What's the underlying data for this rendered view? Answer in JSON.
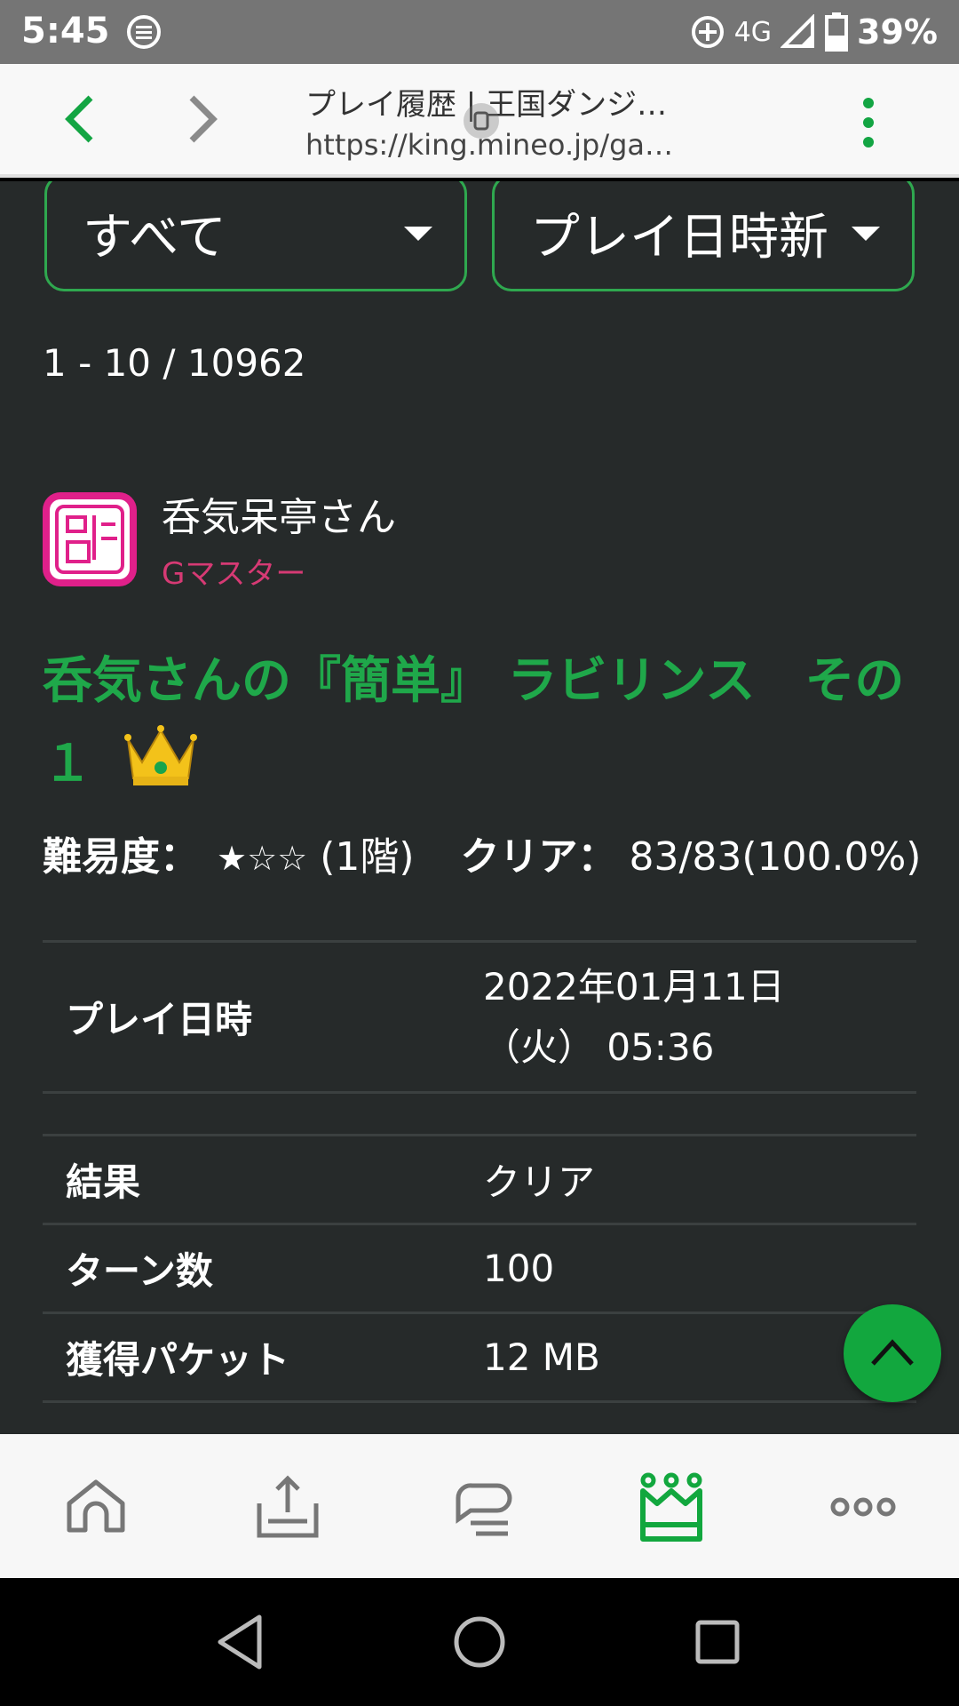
{
  "status": {
    "time": "5:45",
    "network": "4G",
    "battery": "39%"
  },
  "browser": {
    "page_title": "プレイ履歴 | 王国ダンジ…",
    "url": "https://king.mineo.jp/ga…"
  },
  "filters": {
    "category": "すべて",
    "sort": "プレイ日時新"
  },
  "results": {
    "count": "1 - 10 / 10962"
  },
  "entry": {
    "user_name": "呑気呆亭さん",
    "user_rank": "Gマスター",
    "title": "呑気さんの『簡単』 ラビリンス　その１",
    "difficulty_label": "難易度：",
    "difficulty_stars": "★☆☆",
    "difficulty_floors": "(1階)",
    "clear_label": "クリア：",
    "clear_value": "83/83(100.0%)",
    "details": {
      "played_at_label": "プレイ日時",
      "played_at_date": "2022年01月11日",
      "played_at_time": "（火）  05:36",
      "result_label": "結果",
      "result_value": "クリア",
      "turns_label": "ターン数",
      "turns_value": "100",
      "packet_label": "獲得パケット",
      "packet_value": "12 MB"
    }
  },
  "icons": {
    "back": "chevron-left-icon",
    "forward": "chevron-right-icon",
    "menu": "more-vertical-icon",
    "crown": "crown-icon",
    "scroll_top": "chevron-up-icon",
    "tabs": [
      "home-icon",
      "upload-icon",
      "chat-icon",
      "king-icon",
      "more-horizontal-icon"
    ]
  },
  "colors": {
    "accent": "#12a73e",
    "rank": "#d63a74",
    "background": "#262a2a"
  }
}
